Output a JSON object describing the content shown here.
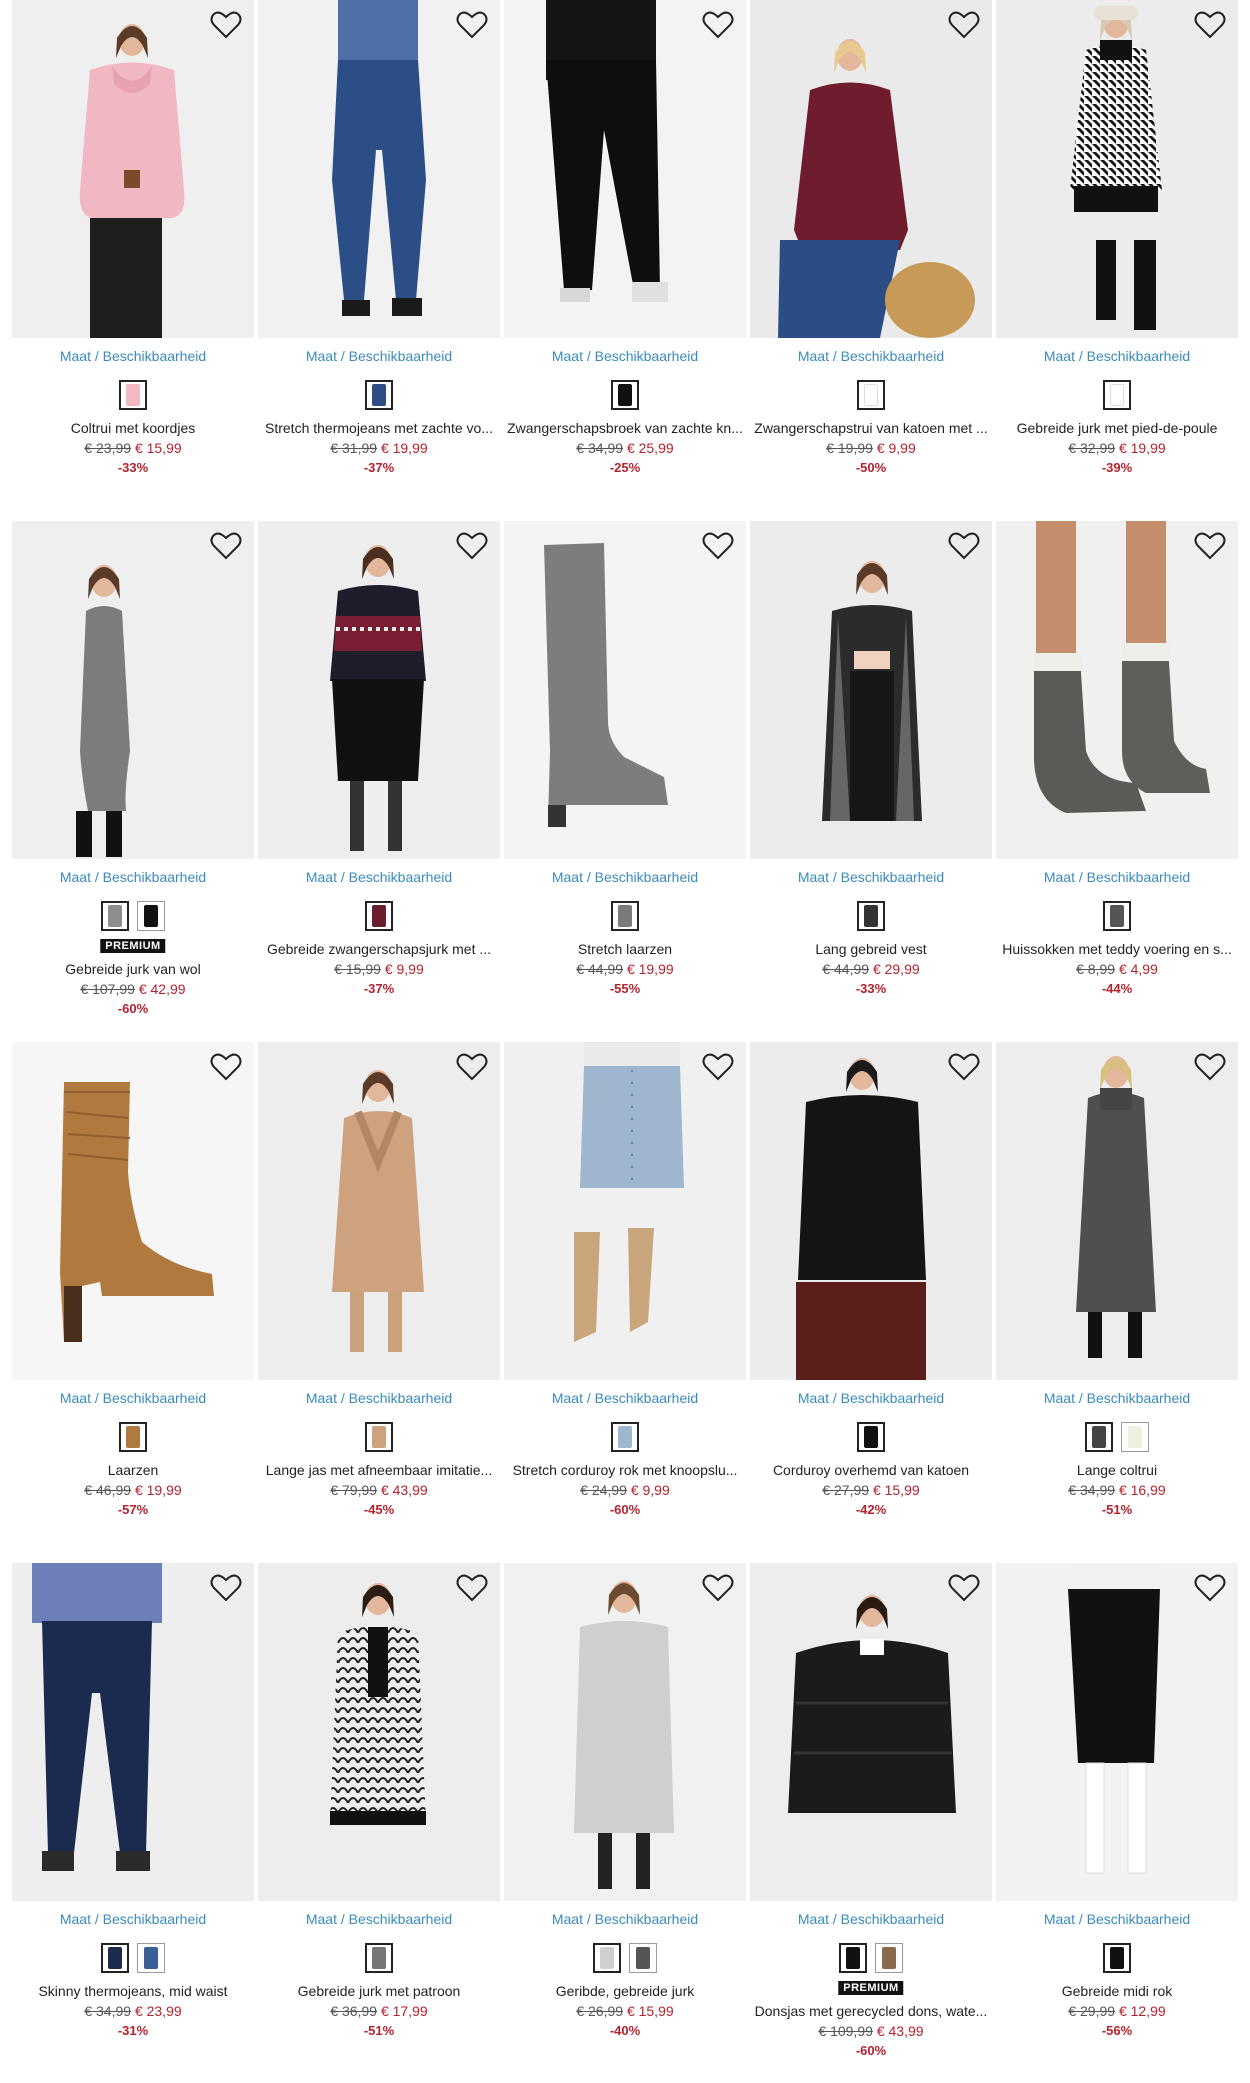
{
  "common": {
    "size_link": "Maat / Beschikbaarheid",
    "premium_badge": "PREMIUM"
  },
  "colors": {
    "accent_link": "#3a8bbb",
    "sale": "#b3232f"
  },
  "products": [
    {
      "name": "Coltrui met koordjes",
      "old_price": "€ 23,99",
      "new_price": "€ 15,99",
      "discount": "-33%",
      "swatches": [
        "#f3b8c4"
      ],
      "premium": false,
      "bg": "#efefef",
      "figure": "pink-sweater"
    },
    {
      "name": "Stretch thermojeans met zachte vo...",
      "old_price": "€ 31,99",
      "new_price": "€ 19,99",
      "discount": "-37%",
      "swatches": [
        "#2d4d84"
      ],
      "premium": false,
      "bg": "#f1f1f1",
      "figure": "jeans"
    },
    {
      "name": "Zwangerschapsbroek van zachte kn...",
      "old_price": "€ 34,99",
      "new_price": "€ 25,99",
      "discount": "-25%",
      "swatches": [
        "#111111"
      ],
      "premium": false,
      "bg": "#f3f3f3",
      "figure": "black-pants"
    },
    {
      "name": "Zwangerschapstrui van katoen met ...",
      "old_price": "€ 19,99",
      "new_price": "€ 9,99",
      "discount": "-50%",
      "swatches": [
        "#ffffff"
      ],
      "premium": false,
      "bg": "#eaeaea",
      "figure": "maroon-top"
    },
    {
      "name": "Gebreide jurk met pied-de-poule",
      "old_price": "€ 32,99",
      "new_price": "€ 19,99",
      "discount": "-39%",
      "swatches": [
        "#ffffff"
      ],
      "premium": false,
      "bg": "#ececec",
      "figure": "houndstooth"
    },
    {
      "name": "Gebreide jurk van wol",
      "old_price": "€ 107,99",
      "new_price": "€ 42,99",
      "discount": "-60%",
      "swatches": [
        "#8d8d8d",
        "#111111"
      ],
      "premium": true,
      "bg": "#efefef",
      "figure": "grey-dress"
    },
    {
      "name": "Gebreide zwangerschapsjurk met ...",
      "old_price": "€ 15,99",
      "new_price": "€ 9,99",
      "discount": "-37%",
      "swatches": [
        "#6a1e2c"
      ],
      "premium": false,
      "bg": "#eeeeee",
      "figure": "fairisle-dress"
    },
    {
      "name": "Stretch laarzen",
      "old_price": "€ 44,99",
      "new_price": "€ 19,99",
      "discount": "-55%",
      "swatches": [
        "#7b7b7b"
      ],
      "premium": false,
      "bg": "#f4f4f4",
      "figure": "grey-boot"
    },
    {
      "name": "Lang gebreid vest",
      "old_price": "€ 44,99",
      "new_price": "€ 29,99",
      "discount": "-33%",
      "swatches": [
        "#333333"
      ],
      "premium": false,
      "bg": "#ececec",
      "figure": "long-cardigan"
    },
    {
      "name": "Huissokken met teddy voering en s...",
      "old_price": "€ 8,99",
      "new_price": "€ 4,99",
      "discount": "-44%",
      "swatches": [
        "#555555"
      ],
      "premium": false,
      "bg": "#f0f0f0",
      "figure": "socks"
    },
    {
      "name": "Laarzen",
      "old_price": "€ 46,99",
      "new_price": "€ 19,99",
      "discount": "-57%",
      "swatches": [
        "#b07a3e"
      ],
      "premium": false,
      "bg": "#f6f6f6",
      "figure": "tan-boot"
    },
    {
      "name": "Lange jas met afneembaar imitatie...",
      "old_price": "€ 79,99",
      "new_price": "€ 43,99",
      "discount": "-45%",
      "swatches": [
        "#cfa27f"
      ],
      "premium": false,
      "bg": "#ededed",
      "figure": "camel-coat"
    },
    {
      "name": "Stretch corduroy rok met knoopslu...",
      "old_price": "€ 24,99",
      "new_price": "€ 9,99",
      "discount": "-60%",
      "swatches": [
        "#9fb6cf"
      ],
      "premium": false,
      "bg": "#f0f0f0",
      "figure": "blue-skirt"
    },
    {
      "name": "Corduroy overhemd van katoen",
      "old_price": "€ 27,99",
      "new_price": "€ 15,99",
      "discount": "-42%",
      "swatches": [
        "#111111"
      ],
      "premium": false,
      "bg": "#ececec",
      "figure": "black-shirt"
    },
    {
      "name": "Lange coltrui",
      "old_price": "€ 34,99",
      "new_price": "€ 16,99",
      "discount": "-51%",
      "swatches": [
        "#444444",
        "#f3efe0"
      ],
      "premium": false,
      "bg": "#ededed",
      "figure": "long-knit"
    },
    {
      "name": "Skinny thermojeans, mid waist",
      "old_price": "€ 34,99",
      "new_price": "€ 23,99",
      "discount": "-31%",
      "swatches": [
        "#1d2b4d",
        "#3a5f95"
      ],
      "premium": false,
      "bg": "#eeeeee",
      "figure": "skinny-jeans"
    },
    {
      "name": "Gebreide jurk met patroon",
      "old_price": "€ 36,99",
      "new_price": "€ 17,99",
      "discount": "-51%",
      "swatches": [
        "#777777"
      ],
      "premium": false,
      "bg": "#ededed",
      "figure": "pattern-dress"
    },
    {
      "name": "Geribde, gebreide jurk",
      "old_price": "€ 26,99",
      "new_price": "€ 15,99",
      "discount": "-40%",
      "swatches": [
        "#cfcfcf",
        "#555555"
      ],
      "premium": false,
      "bg": "#f1f1f1",
      "figure": "rib-dress"
    },
    {
      "name": "Donsjas met gerecycled dons, wate...",
      "old_price": "€ 109,99",
      "new_price": "€ 43,99",
      "discount": "-60%",
      "swatches": [
        "#111111",
        "#8a6b4a"
      ],
      "premium": true,
      "bg": "#ededed",
      "figure": "puffer"
    },
    {
      "name": "Gebreide midi rok",
      "old_price": "€ 29,99",
      "new_price": "€ 12,99",
      "discount": "-56%",
      "swatches": [
        "#111111"
      ],
      "premium": false,
      "bg": "#f2f2f2",
      "figure": "midi-skirt"
    }
  ]
}
